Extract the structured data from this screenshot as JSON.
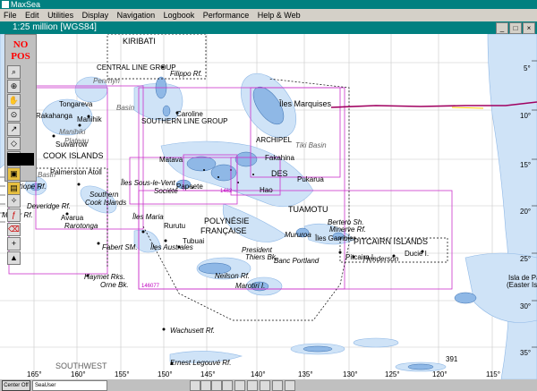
{
  "window": {
    "title": "MaxSea"
  },
  "menu": [
    "File",
    "Edit",
    "Utilities",
    "Display",
    "Navigation",
    "Logbook",
    "Performance",
    "Help & Web"
  ],
  "chart": {
    "scale_label": "1:25 million [WGS84]"
  },
  "toolbox": {
    "position_status": [
      "NO",
      "POS"
    ]
  },
  "map": {
    "colors": {
      "land": "#8fb8e6",
      "shallow": "#cfe3f7",
      "grid": "#c8c8c8",
      "boundary": "#cc33cc",
      "track": "#a00060"
    },
    "labels": [
      {
        "id": "kiribati",
        "text": "KIRIBATI",
        "big": true
      },
      {
        "id": "central-line",
        "text": "CENTRAL LINE GROUP"
      },
      {
        "id": "filippo",
        "text": "Filippo Rf."
      },
      {
        "id": "penrhyn",
        "text": "Penrhyn"
      },
      {
        "id": "basin1",
        "text": "Basin"
      },
      {
        "id": "caroline",
        "text": "Caroline"
      },
      {
        "id": "southern-line",
        "text": "SOUTHERN LINE GROUP"
      },
      {
        "id": "tongareva",
        "text": "Tongareva"
      },
      {
        "id": "rakahanga",
        "text": "Rakahanga"
      },
      {
        "id": "manihik",
        "text": "Manihik"
      },
      {
        "id": "manihiki",
        "text": "Manihiki"
      },
      {
        "id": "plateau",
        "text": "Plateau"
      },
      {
        "id": "suwarrow",
        "text": "Suwarrow"
      },
      {
        "id": "cook",
        "text": "COOK ISLANDS",
        "big": true
      },
      {
        "id": "basin2",
        "text": "Basin"
      },
      {
        "id": "palmerston",
        "text": "Palmerston Atoll"
      },
      {
        "id": "antiope",
        "text": "Antiope Rf."
      },
      {
        "id": "deveridge",
        "text": "Deveridge Rf."
      },
      {
        "id": "meyer",
        "text": "Meyer Rf."
      },
      {
        "id": "southern",
        "text": "Southern"
      },
      {
        "id": "cook-isl",
        "text": "Cook Islands"
      },
      {
        "id": "avarua",
        "text": "Avarua"
      },
      {
        "id": "rarotonga",
        "text": "Rarotonga"
      },
      {
        "id": "iles-sous",
        "text": "Îles Sous-le-Vent"
      },
      {
        "id": "societe",
        "text": "Société"
      },
      {
        "id": "matava",
        "text": "Matava"
      },
      {
        "id": "papeete",
        "text": "Papeete"
      },
      {
        "id": "iles-maria",
        "text": "Îles Maria"
      },
      {
        "id": "rurutu",
        "text": "Rurutu"
      },
      {
        "id": "tubuai",
        "text": "Tubuai"
      },
      {
        "id": "polynesie",
        "text": "POLYNÉSIE",
        "big": true
      },
      {
        "id": "francaise",
        "text": "FRANÇAISE",
        "big": true
      },
      {
        "id": "iles-marquises",
        "text": "Îles Marquises",
        "big": true
      },
      {
        "id": "tiki",
        "text": "Tiki Basin"
      },
      {
        "id": "archipel",
        "text": "ARCHIPEL"
      },
      {
        "id": "des",
        "text": "DES"
      },
      {
        "id": "tuamotu",
        "text": "TUAMOTU"
      },
      {
        "id": "fakahina",
        "text": "Fakahina"
      },
      {
        "id": "hao",
        "text": "Hao"
      },
      {
        "id": "pukarua",
        "text": "Pukarua"
      },
      {
        "id": "president",
        "text": "President"
      },
      {
        "id": "thiers",
        "text": "Thiers Bk."
      },
      {
        "id": "mururoa",
        "text": "Mururoa"
      },
      {
        "id": "bertero",
        "text": "Bertero Sh."
      },
      {
        "id": "minerve",
        "text": "Minerve Rf."
      },
      {
        "id": "gambier",
        "text": "Îles Gambier"
      },
      {
        "id": "banc-portland",
        "text": "Banc Portland"
      },
      {
        "id": "pitcairn",
        "text": "PITCAIRN ISLANDS",
        "big": true
      },
      {
        "id": "pitcairn-i",
        "text": "Pitcairn I."
      },
      {
        "id": "henderson",
        "text": "Henderson"
      },
      {
        "id": "ducie",
        "text": "Ducie I."
      },
      {
        "id": "fabert",
        "text": "Fabert SM."
      },
      {
        "id": "haymet",
        "text": "Haymet Rks."
      },
      {
        "id": "orne",
        "text": "Orne Bk."
      },
      {
        "id": "neilson",
        "text": "Neilson Rf."
      },
      {
        "id": "marotiri",
        "text": "Marotiri I."
      },
      {
        "id": "iles-australes",
        "text": "Îles Australes"
      },
      {
        "id": "wachusett",
        "text": "Wachusett Rf."
      },
      {
        "id": "ernest",
        "text": "Ernest Legouvé Rf."
      },
      {
        "id": "southwest",
        "text": "SOUTHWEST"
      },
      {
        "id": "isla-de-pascua",
        "text": "Isla de Pascua"
      },
      {
        "id": "easter",
        "text": "(Easter Isla"
      },
      {
        "id": "depth-391",
        "text": "391"
      },
      {
        "id": "chart-146077",
        "text": "146077",
        "magenta": true
      },
      {
        "id": "chart-1462",
        "text": "1462",
        "magenta": true
      }
    ],
    "lon_ticks": [
      "165°",
      "160°",
      "155°",
      "150°",
      "145°",
      "140°",
      "135°",
      "130°",
      "125°",
      "120°",
      "115°"
    ],
    "lat_ticks": [
      "5°",
      "10°",
      "15°",
      "20°",
      "25°",
      "30°",
      "35°"
    ]
  },
  "status": {
    "center_label": "Center Off",
    "user_field": "SeaUser"
  }
}
